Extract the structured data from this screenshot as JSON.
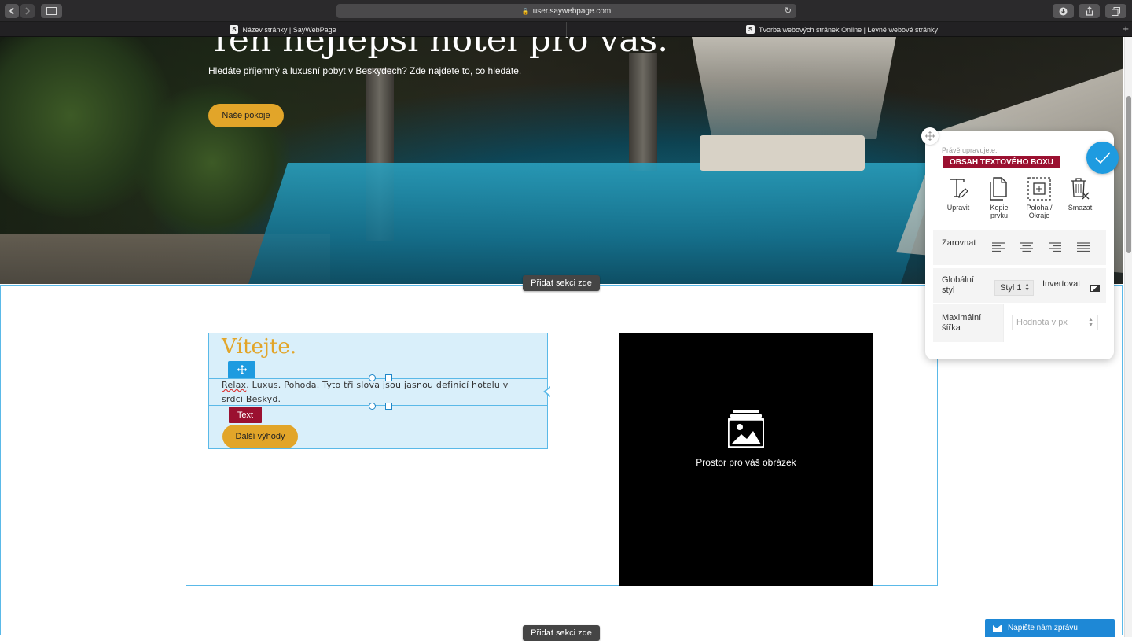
{
  "browser": {
    "url": "user.saywebpage.com",
    "tabs": [
      {
        "label": "Název stránky | SayWebPage"
      },
      {
        "label": "Tvorba webových stránek Online | Levné webové stránky"
      }
    ],
    "new_tab": "+"
  },
  "hero": {
    "title": "Ten nejlepší hotel pro vás.",
    "subtitle": "Hledáte příjemný a luxusní pobyt v Beskydech? Zde najdete to, co hledáte.",
    "button": "Naše pokoje"
  },
  "add_section_label": "Přidat sekci zde",
  "content": {
    "title": "Vítejte.",
    "text_lead": "Relax",
    "text_rest": ". Luxus. Pohoda. Tyto tři slova jsou jasnou definicí hotelu v srdci Beskyd.",
    "tag": "Text",
    "button": "Další výhody"
  },
  "image_placeholder": {
    "label": "Prostor pro váš obrázek",
    "icon": "image-icon"
  },
  "panel": {
    "caption": "Právě upravujete:",
    "badge": "OBSAH TEXTOVÉHO BOXU",
    "tools": [
      {
        "label": "Upravit",
        "icon": "edit-text-icon"
      },
      {
        "label": "Kopie prvku",
        "icon": "copy-icon"
      },
      {
        "label": "Poloha / Okraje",
        "icon": "position-icon"
      },
      {
        "label": "Smazat",
        "icon": "delete-icon"
      }
    ],
    "align_label": "Zarovnat",
    "global_style_label": "Globální styl",
    "style_value": "Styl 1",
    "invert_label": "Invertovat",
    "max_width_label": "Maximální šířka",
    "max_width_placeholder": "Hodnota v px"
  },
  "chat": {
    "label": "Napište nám zprávu",
    "icon": "mail-icon"
  },
  "colors": {
    "accent": "#e2a529",
    "edit_blue": "#1e9be0",
    "badge_red": "#9b1030"
  }
}
